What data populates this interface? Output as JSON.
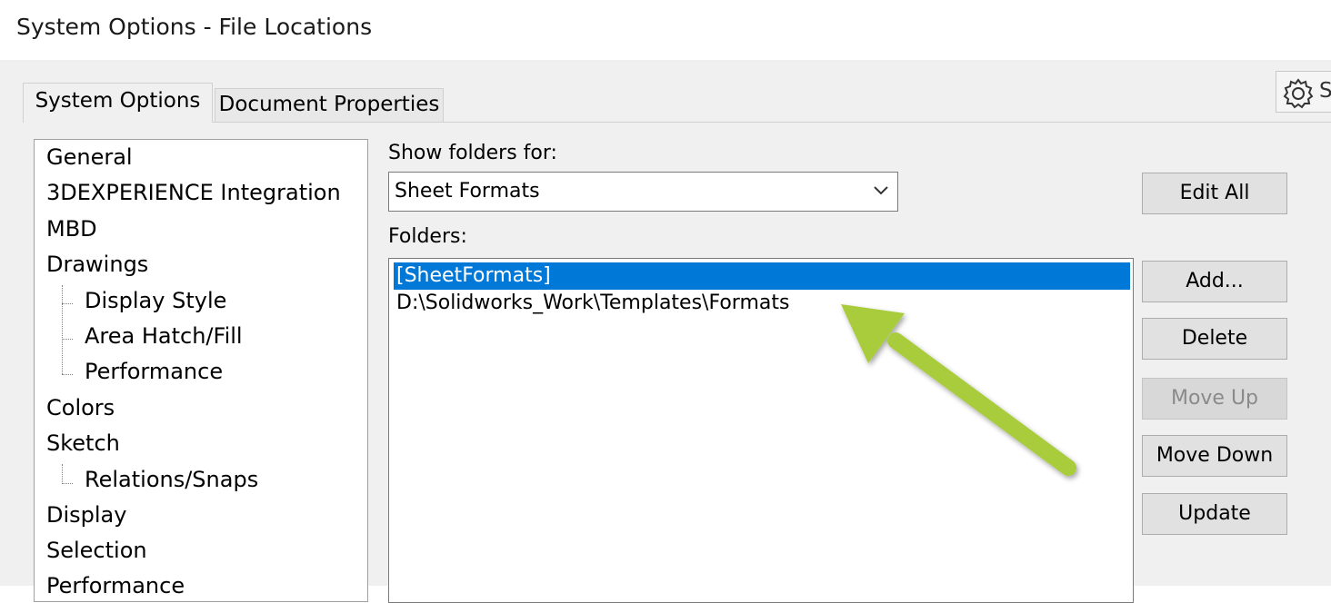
{
  "window": {
    "title": "System Options - File Locations"
  },
  "tabs": [
    {
      "label": "System Options",
      "active": true
    },
    {
      "label": "Document Properties",
      "active": false
    }
  ],
  "settings_button": {
    "icon": "gear-icon",
    "partial_label": "S"
  },
  "tree": {
    "items": [
      {
        "label": "General",
        "level": 0
      },
      {
        "label": "3DEXPERIENCE Integration",
        "level": 0
      },
      {
        "label": "MBD",
        "level": 0
      },
      {
        "label": "Drawings",
        "level": 0
      },
      {
        "label": "Display Style",
        "level": 1
      },
      {
        "label": "Area Hatch/Fill",
        "level": 1
      },
      {
        "label": "Performance",
        "level": 1
      },
      {
        "label": "Colors",
        "level": 0
      },
      {
        "label": "Sketch",
        "level": 0
      },
      {
        "label": "Relations/Snaps",
        "level": 1
      },
      {
        "label": "Display",
        "level": 0
      },
      {
        "label": "Selection",
        "level": 0
      },
      {
        "label": "Performance",
        "level": 0
      }
    ]
  },
  "show_folders": {
    "label": "Show folders for:",
    "selected": "Sheet Formats"
  },
  "folders": {
    "label": "Folders:",
    "items": [
      {
        "text": "[SheetFormats]",
        "selected": true
      },
      {
        "text": "D:\\Solidworks_Work\\Templates\\Formats",
        "selected": false
      }
    ]
  },
  "buttons": {
    "edit_all": "Edit All",
    "add": "Add...",
    "delete": "Delete",
    "move_up": "Move Up",
    "move_down": "Move Down",
    "update": "Update"
  },
  "colors": {
    "selection": "#0078d7",
    "annotation_arrow": "#a8cc3a"
  }
}
